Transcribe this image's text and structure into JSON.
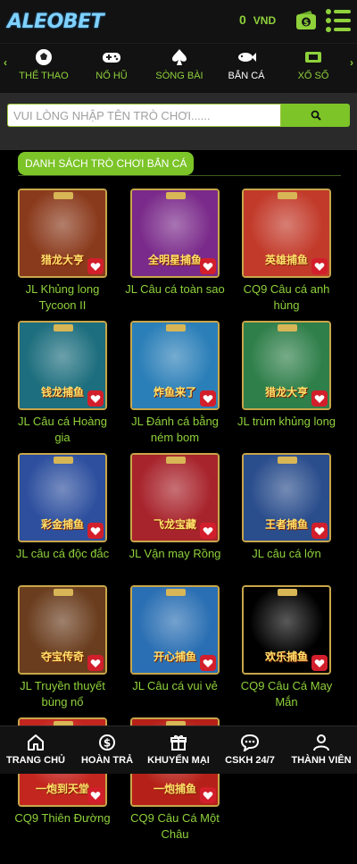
{
  "header": {
    "logo": "ALEOBET",
    "balance_value": "0",
    "balance_currency": "VND"
  },
  "categories": [
    {
      "label": "THỂ THAO",
      "icon": "soccer-ball-icon",
      "active": false
    },
    {
      "label": "NỔ HŨ",
      "icon": "gamepad-icon",
      "active": false
    },
    {
      "label": "SÒNG BÀI",
      "icon": "spade-icon",
      "active": false
    },
    {
      "label": "BẮN CÁ",
      "icon": "fish-icon",
      "active": true
    },
    {
      "label": "XỔ SỐ",
      "icon": "lottery-ticket-icon",
      "active": false
    }
  ],
  "search": {
    "placeholder": "VUI LÒNG NHẬP TÊN TRÒ CHƠI......"
  },
  "section": {
    "title": "DANH SÁCH TRÒ CHƠI BẮN CÁ"
  },
  "games": [
    {
      "name": "JL Khủng long Tycoon II",
      "art_text": "猎龙大亨",
      "bg": "#8a3a1c"
    },
    {
      "name": "JL Câu cá toàn sao",
      "art_text": "全明星捕鱼",
      "bg": "#7a2a8a"
    },
    {
      "name": "CQ9 Câu cá anh hùng",
      "art_text": "英雄捕鱼",
      "bg": "#c23a2a"
    },
    {
      "name": "JL Câu cá Hoàng gia",
      "art_text": "钱龙捕鱼",
      "bg": "#1d6e7e"
    },
    {
      "name": "JL Đánh cá bằng ném bom",
      "art_text": "炸鱼来了",
      "bg": "#2b7fb8"
    },
    {
      "name": "JL trùm khủng long",
      "art_text": "猎龙大亨",
      "bg": "#2f7f4a"
    },
    {
      "name": "JL câu cá độc đắc",
      "art_text": "彩金捕鱼",
      "bg": "#2d4f9e"
    },
    {
      "name": "JL Vận may Rồng",
      "art_text": "飞龙宝藏",
      "bg": "#a8242c"
    },
    {
      "name": "JL câu cá lớn",
      "art_text": "王者捕鱼",
      "bg": "#2a4d8c"
    },
    {
      "name": "JL Truyền thuyết bùng nổ",
      "art_text": "夺宝传奇",
      "bg": "#6a3d1e"
    },
    {
      "name": "JL Câu cá vui vẻ",
      "art_text": "开心捕鱼",
      "bg": "#2a6fb3"
    },
    {
      "name": "CQ9 Câu Cá May Mắn",
      "art_text": "欢乐捕鱼",
      "bg": "#000000"
    },
    {
      "name": "CQ9 Thiên Đường",
      "art_text": "一炮到天堂",
      "bg": "#c3261f"
    },
    {
      "name": "CQ9 Câu Cá Một Châu",
      "art_text": "一炮捕鱼",
      "bg": "#b52118"
    }
  ],
  "bottom_nav": [
    {
      "label": "TRANG CHỦ",
      "icon": "home-icon"
    },
    {
      "label": "HOÀN TRẢ",
      "icon": "dollar-circle-icon"
    },
    {
      "label": "KHUYẾN MẠI",
      "icon": "gift-icon"
    },
    {
      "label": "CSKH 24/7",
      "icon": "chat-icon"
    },
    {
      "label": "THÀNH VIÊN",
      "icon": "user-icon"
    }
  ],
  "colors": {
    "accent": "#7cc428",
    "heart": "#d21f2b",
    "background": "#000000"
  }
}
